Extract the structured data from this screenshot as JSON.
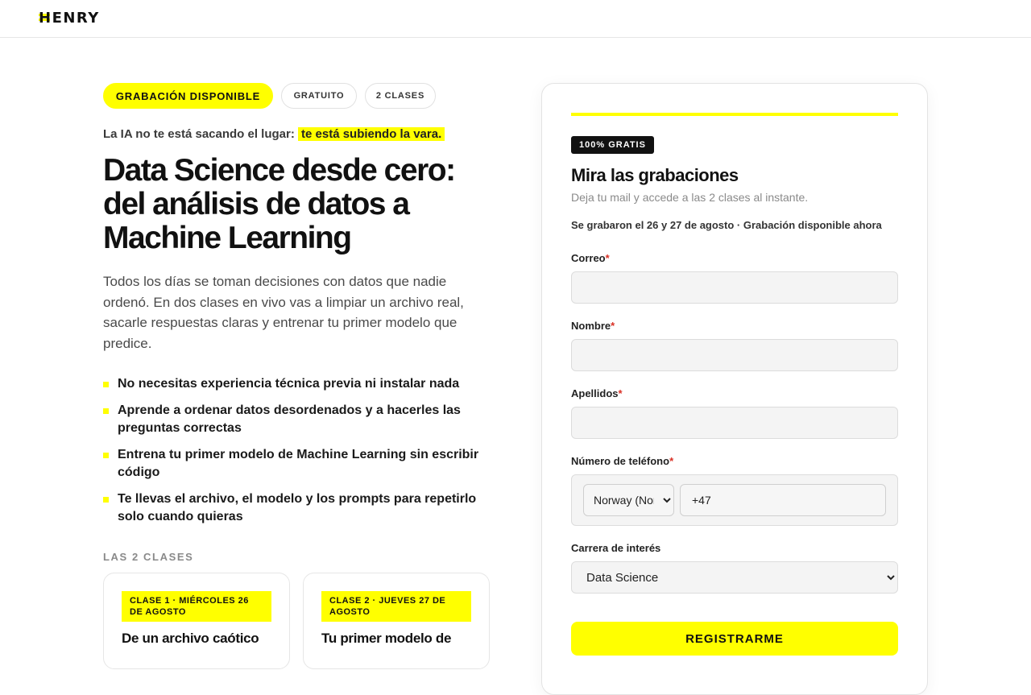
{
  "header": {
    "logo_text": "HENRY"
  },
  "hero": {
    "pills": [
      "GRABACIÓN DISPONIBLE",
      "GRATUITO",
      "2 CLASES"
    ],
    "kicker_text": "La IA no te está sacando el lugar:",
    "kicker_highlight": "te está subiendo la vara.",
    "headline": "Data Science desde cero: del análisis de datos a Machine Learning",
    "lead": "Todos los días se toman decisiones con datos que nadie ordenó. En dos clases en vivo vas a limpiar un archivo real, sacarle respuestas claras y entrenar tu primer modelo que predice.",
    "bullets": [
      "No necesitas experiencia técnica previa ni instalar nada",
      "Aprende a ordenar datos desordenados y a hacerles las preguntas correctas",
      "Entrena tu primer modelo de Machine Learning sin escribir código",
      "Te llevas el archivo, el modelo y los prompts para repetirlo solo cuando quieras"
    ],
    "classes_label": "LAS 2 CLASES",
    "classes": [
      {
        "tag": "CLASE 1 · MIÉRCOLES 26 DE AGOSTO",
        "title": "De un archivo caótico"
      },
      {
        "tag": "CLASE 2 · JUEVES 27 DE AGOSTO",
        "title": "Tu primer modelo de"
      }
    ]
  },
  "form": {
    "badge": "100% GRATIS",
    "title": "Mira las grabaciones",
    "subtitle": "Deja tu mail y accede a las 2 clases al instante.",
    "note": "Se grabaron el 26 y 27 de agosto · Grabación disponible ahora",
    "required_mark": "*",
    "email_label": "Correo",
    "email_value": "",
    "first_name_label": "Nombre",
    "first_name_value": "",
    "last_name_label": "Apellidos",
    "last_name_value": "",
    "phone_label": "Número de teléfono",
    "phone_country": "Norway (Norge)",
    "phone_value": "+47",
    "career_label": "Carrera de interés",
    "career_value": "Data Science",
    "submit_label": "REGISTRARME"
  },
  "colors": {
    "accent": "#ffff00",
    "text": "#111111",
    "muted": "#8a8a8a",
    "required": "#d93025"
  }
}
